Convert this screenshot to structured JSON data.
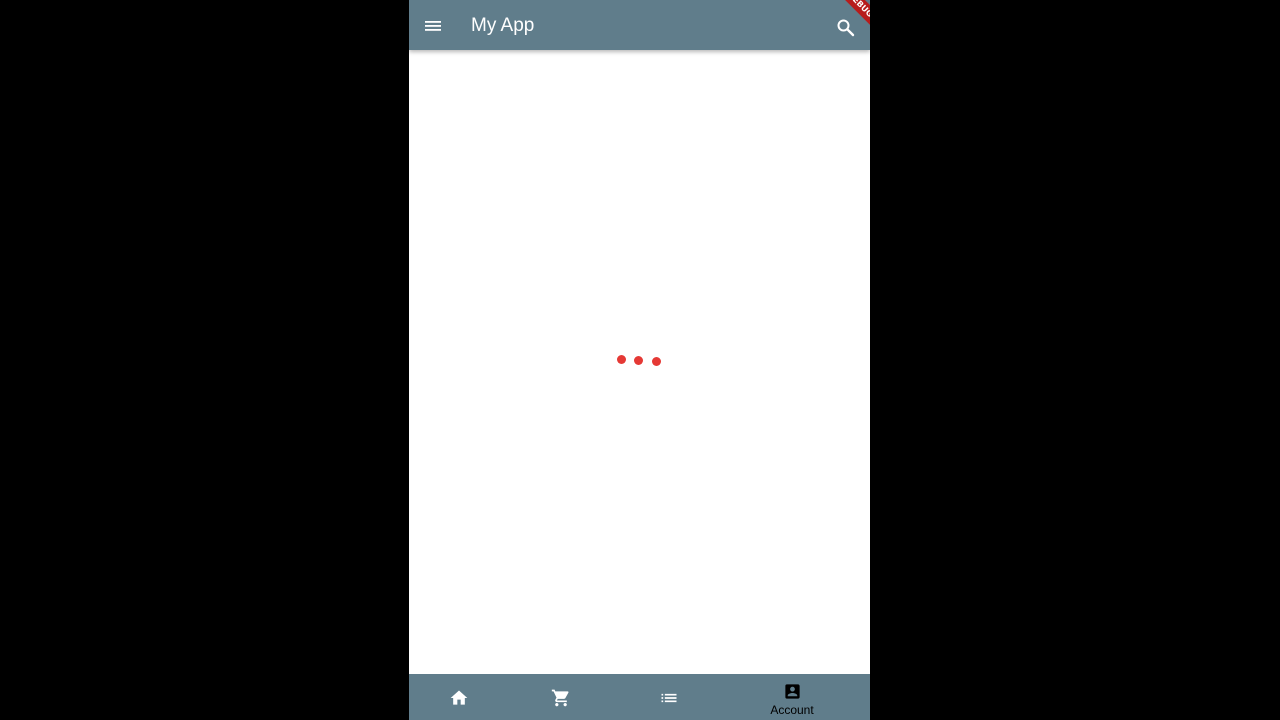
{
  "app_bar": {
    "title": "My App",
    "menu_icon": "menu-icon",
    "search_icon": "search-icon",
    "background": "#607d8b"
  },
  "debug_banner": {
    "text": "DEBUG",
    "color": "#b71c1c"
  },
  "loader": {
    "dot_color": "#e53935",
    "dot_count": 3
  },
  "bottom_nav": {
    "background": "#607d8b",
    "items": [
      {
        "icon": "home-icon",
        "label": "",
        "active": false
      },
      {
        "icon": "cart-icon",
        "label": "",
        "active": false
      },
      {
        "icon": "list-icon",
        "label": "",
        "active": false
      },
      {
        "icon": "account-box-icon",
        "label": "Account",
        "active": true
      }
    ]
  }
}
